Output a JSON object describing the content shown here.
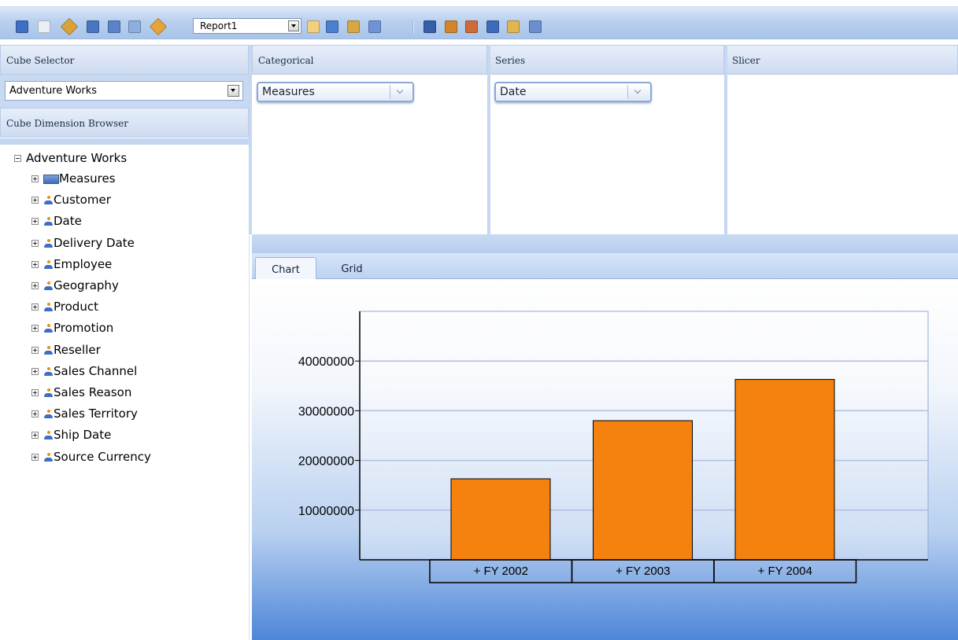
{
  "toolbar": {
    "report_combo_value": "Report1",
    "icons": [
      "save-icon",
      "new-report-icon",
      "open-icon",
      "undo-icon",
      "redo-icon",
      "refresh-icon",
      "tag-icon",
      "chart-type-icon",
      "layout-icon",
      "mdx-icon",
      "properties-icon",
      "export-icon",
      "print-icon",
      "add-report-icon",
      "panel-icon",
      "clear-icon",
      "settings-icon"
    ]
  },
  "left_panel": {
    "cube_selector_label": "Cube Selector",
    "cube_selected": "Adventure Works",
    "dimension_browser_label": "Cube Dimension Browser",
    "tree": {
      "root": "Adventure Works",
      "items": [
        "Measures",
        "Customer",
        "Date",
        "Delivery Date",
        "Employee",
        "Geography",
        "Product",
        "Promotion",
        "Reseller",
        "Sales Channel",
        "Sales Reason",
        "Sales Territory",
        "Ship Date",
        "Source Currency"
      ]
    }
  },
  "zones": {
    "categorical": {
      "label": "Categorical",
      "pill": "Measures"
    },
    "series": {
      "label": "Series",
      "pill": "Date"
    },
    "slicer": {
      "label": "Slicer"
    }
  },
  "tabs": {
    "chart": "Chart",
    "grid": "Grid"
  },
  "colors": {
    "bar": "#f5820f",
    "grid_line": "#aebfe0"
  },
  "chart_data": {
    "type": "bar",
    "categories": [
      "+ FY 2002",
      "+ FY 2003",
      "+ FY 2004"
    ],
    "values": [
      16300000,
      28000000,
      36300000
    ],
    "y_ticks": [
      10000000,
      20000000,
      30000000,
      40000000
    ],
    "y_tick_labels": [
      "10000000",
      "20000000",
      "30000000",
      "40000000"
    ],
    "ylim": [
      0,
      50000000
    ],
    "grid": true
  }
}
